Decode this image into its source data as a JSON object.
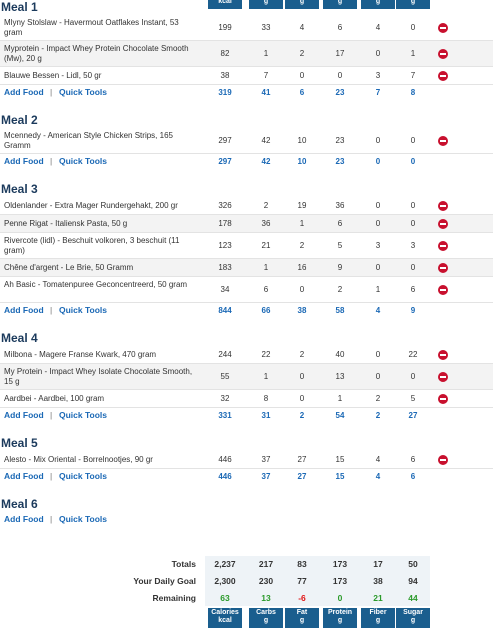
{
  "columns": [
    {
      "l1": "Calories",
      "l2": "kcal"
    },
    {
      "l1": "Carbs",
      "l2": "g"
    },
    {
      "l1": "Fat",
      "l2": "g"
    },
    {
      "l1": "Protein",
      "l2": "g"
    },
    {
      "l1": "Fiber",
      "l2": "g"
    },
    {
      "l1": "Sugar",
      "l2": "g"
    }
  ],
  "links": {
    "add_food": "Add Food",
    "quick_tools": "Quick Tools",
    "separator": "|"
  },
  "meals": [
    {
      "title": "Meal 1",
      "foods": [
        {
          "name": "Mlyny Stolslaw - Havermout Oatflakes Instant, 53 gram",
          "vals": [
            "199",
            "33",
            "4",
            "6",
            "4",
            "0"
          ]
        },
        {
          "name": "Myprotein - Impact Whey Protein Chocolate Smooth (Mw), 20 g",
          "vals": [
            "82",
            "1",
            "2",
            "17",
            "0",
            "1"
          ]
        },
        {
          "name": "Blauwe Bessen - Lidl, 50 gr",
          "vals": [
            "38",
            "7",
            "0",
            "0",
            "3",
            "7"
          ]
        }
      ],
      "totals": [
        "319",
        "41",
        "6",
        "23",
        "7",
        "8"
      ]
    },
    {
      "title": "Meal 2",
      "foods": [
        {
          "name": "Mcennedy - American Style Chicken Strips, 165 Gramm",
          "vals": [
            "297",
            "42",
            "10",
            "23",
            "0",
            "0"
          ]
        }
      ],
      "totals": [
        "297",
        "42",
        "10",
        "23",
        "0",
        "0"
      ]
    },
    {
      "title": "Meal 3",
      "foods": [
        {
          "name": "Oldenlander - Extra Mager Rundergehakt, 200 gr",
          "vals": [
            "326",
            "2",
            "19",
            "36",
            "0",
            "0"
          ]
        },
        {
          "name": "Penne Rigat - Italiensk Pasta, 50 g",
          "vals": [
            "178",
            "36",
            "1",
            "6",
            "0",
            "0"
          ]
        },
        {
          "name": "Rivercote (lidl) - Beschuit volkoren, 3 beschuit (11 gram)",
          "vals": [
            "123",
            "21",
            "2",
            "5",
            "3",
            "3"
          ]
        },
        {
          "name": "Chêne d'argent - Le Brie, 50 Gramm",
          "vals": [
            "183",
            "1",
            "16",
            "9",
            "0",
            "0"
          ]
        },
        {
          "name": "Ah Basic - Tomatenpuree Geconcentreerd, 50 gram",
          "vals": [
            "34",
            "6",
            "0",
            "2",
            "1",
            "6"
          ]
        }
      ],
      "totals": [
        "844",
        "66",
        "38",
        "58",
        "4",
        "9"
      ]
    },
    {
      "title": "Meal 4",
      "foods": [
        {
          "name": "Milbona - Magere Franse Kwark, 470 gram",
          "vals": [
            "244",
            "22",
            "2",
            "40",
            "0",
            "22"
          ]
        },
        {
          "name": "My Protein - Impact Whey Isolate Chocolate Smooth, 15 g",
          "vals": [
            "55",
            "1",
            "0",
            "13",
            "0",
            "0"
          ]
        },
        {
          "name": "Aardbei - Aardbei, 100 gram",
          "vals": [
            "32",
            "8",
            "0",
            "1",
            "2",
            "5"
          ]
        }
      ],
      "totals": [
        "331",
        "31",
        "2",
        "54",
        "2",
        "27"
      ]
    },
    {
      "title": "Meal 5",
      "foods": [
        {
          "name": "Alesto - Mix Oriental - Borrelnootjes, 90 gr",
          "vals": [
            "446",
            "37",
            "27",
            "15",
            "4",
            "6"
          ]
        }
      ],
      "totals": [
        "446",
        "37",
        "27",
        "15",
        "4",
        "6"
      ]
    },
    {
      "title": "Meal 6",
      "foods": [],
      "totals": null
    }
  ],
  "summary": {
    "totals_label": "Totals",
    "goal_label": "Your Daily Goal",
    "remaining_label": "Remaining",
    "totals": [
      "2,237",
      "217",
      "83",
      "173",
      "17",
      "50"
    ],
    "goal": [
      "2,300",
      "230",
      "77",
      "173",
      "38",
      "94"
    ],
    "remaining": [
      "63",
      "13",
      "-6",
      "0",
      "21",
      "44"
    ],
    "colors": {
      "positive": "#2a9a2a",
      "negative": "#e11111",
      "header_bg": "#1a5e8e",
      "link": "#1a68b5"
    }
  }
}
